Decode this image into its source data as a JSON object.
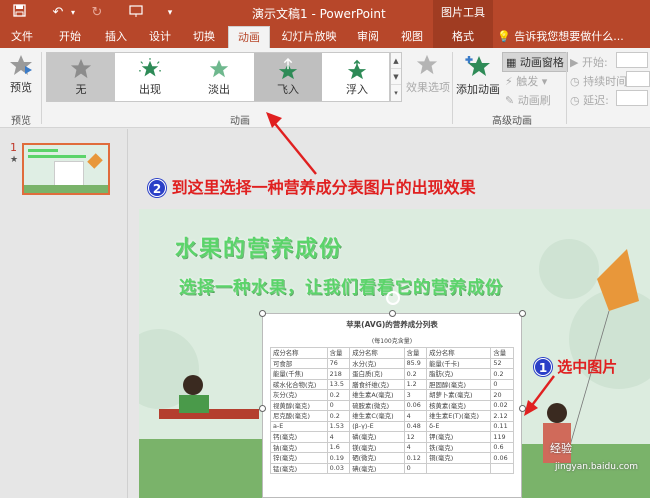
{
  "titlebar": {
    "title": "演示文稿1 - PowerPoint",
    "context_tool": "图片工具"
  },
  "tabs": [
    {
      "label": "文件"
    },
    {
      "label": "开始"
    },
    {
      "label": "插入"
    },
    {
      "label": "设计"
    },
    {
      "label": "切换"
    },
    {
      "label": "动画"
    },
    {
      "label": "幻灯片放映"
    },
    {
      "label": "审阅"
    },
    {
      "label": "视图"
    },
    {
      "label": "格式"
    }
  ],
  "tell_me": "告诉我您想要做什么...",
  "ribbon": {
    "preview_label": "预览",
    "preview_group": "预览",
    "gallery": [
      {
        "label": "无"
      },
      {
        "label": "出现"
      },
      {
        "label": "淡出"
      },
      {
        "label": "飞入"
      },
      {
        "label": "浮入"
      }
    ],
    "effect_options": "效果选项",
    "animation_group": "动画",
    "add_animation": "添加动画",
    "animation_pane": "动画窗格",
    "trigger": "触发",
    "animation_painter": "动画刷",
    "advanced_group": "高级动画",
    "start": "开始:",
    "duration": "持续时间:",
    "delay": "延迟:"
  },
  "slides": [
    {
      "number": "1",
      "star": "★"
    }
  ],
  "annotations": {
    "step2": "到这里选择一种营养成分表图片的出现效果",
    "step2_num": "2",
    "step1": "选中图片",
    "step1_num": "1"
  },
  "slide": {
    "title": "水果的营养成份",
    "subtitle": "选择一种水果，让我们看看它的营养成份"
  },
  "nutrition": {
    "title": "苹果(AVG)的营养成分列表",
    "subtitle": "(每100克含量)",
    "rows": [
      [
        "成分名称",
        "含量",
        "成分名称",
        "含量",
        "成分名称",
        "含量"
      ],
      [
        "可食部",
        "76",
        "水分(克)",
        "85.9",
        "能量(千卡)",
        "52"
      ],
      [
        "能量(千焦)",
        "218",
        "蛋白质(克)",
        "0.2",
        "脂肪(克)",
        "0.2"
      ],
      [
        "碳水化合物(克)",
        "13.5",
        "膳食纤维(克)",
        "1.2",
        "胆固醇(毫克)",
        "0"
      ],
      [
        "灰分(克)",
        "0.2",
        "维生素A(毫克)",
        "3",
        "胡萝卜素(毫克)",
        "20"
      ],
      [
        "视黄醇(毫克)",
        "0",
        "硫胺素(微克)",
        "0.06",
        "核黄素(毫克)",
        "0.02"
      ],
      [
        "尼克酸(毫克)",
        "0.2",
        "维生素C(毫克)",
        "4",
        "维生素E(T)(毫克)",
        "2.12"
      ],
      [
        "a-E",
        "1.53",
        "(β-γ)-E",
        "0.48",
        "δ-E",
        "0.11"
      ],
      [
        "钙(毫克)",
        "4",
        "磷(毫克)",
        "12",
        "钾(毫克)",
        "119"
      ],
      [
        "钠(毫克)",
        "1.6",
        "镁(毫克)",
        "4",
        "铁(毫克)",
        "0.6"
      ],
      [
        "锌(毫克)",
        "0.19",
        "硒(微克)",
        "0.12",
        "铜(毫克)",
        "0.06"
      ],
      [
        "锰(毫克)",
        "0.03",
        "碘(毫克)",
        "0",
        "",
        ""
      ]
    ]
  },
  "watermark": {
    "brand": "经验",
    "site": "jingyan.baidu.com"
  }
}
